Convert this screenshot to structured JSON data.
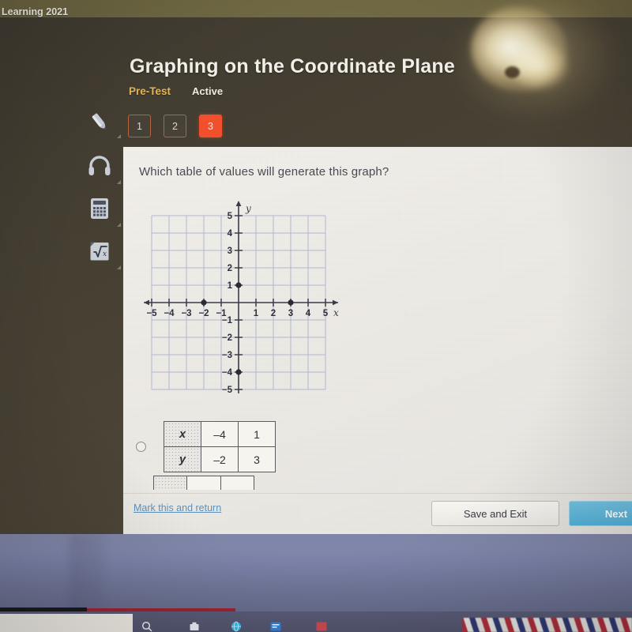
{
  "browser": {
    "tab_label": "Learning 2021"
  },
  "header": {
    "title": "Graphing on the Coordinate Plane",
    "pretest_label": "Pre-Test",
    "status_label": "Active",
    "accent_orange": "#F2502C",
    "pretest_color": "#E7B54A"
  },
  "pager": {
    "items": [
      {
        "label": "1",
        "active": false
      },
      {
        "label": "2",
        "active": false
      },
      {
        "label": "3",
        "active": true
      }
    ]
  },
  "tools": {
    "items": [
      {
        "name": "pencil-icon",
        "label": "Pencil"
      },
      {
        "name": "headphones-icon",
        "label": "Headphones"
      },
      {
        "name": "calculator-icon",
        "label": "Calculator"
      },
      {
        "name": "square-root-icon",
        "label": "Square Root"
      }
    ]
  },
  "question": {
    "prompt": "Which table of values will generate this graph?"
  },
  "chart_data": {
    "type": "scatter",
    "title": "",
    "xlabel": "x",
    "ylabel": "y",
    "xlim": [
      -5,
      5
    ],
    "ylim": [
      -5,
      5
    ],
    "grid": true,
    "x_ticks": [
      "-5",
      "-4",
      "-3",
      "-2",
      "-1",
      "1",
      "2",
      "3",
      "4",
      "5"
    ],
    "y_ticks": [
      "5",
      "4",
      "3",
      "2",
      "1",
      "-1",
      "-2",
      "-3",
      "-4",
      "-5"
    ],
    "points": [
      {
        "x": 0,
        "y": 1
      },
      {
        "x": -2,
        "y": 0
      },
      {
        "x": 3,
        "y": 0
      },
      {
        "x": 0,
        "y": -4
      }
    ],
    "axis_color": "#3b3b46",
    "grid_color": "#a9aecb"
  },
  "options": [
    {
      "selected": false,
      "rows": [
        {
          "header": "x",
          "cells": [
            "–4",
            "1"
          ]
        },
        {
          "header": "y",
          "cells": [
            "–2",
            "3"
          ]
        }
      ]
    }
  ],
  "footer": {
    "mark_link": "Mark this and return",
    "save_label": "Save and Exit",
    "next_label": "Next",
    "next_color": "#53B2DA",
    "link_color": "#5D8FB8"
  }
}
